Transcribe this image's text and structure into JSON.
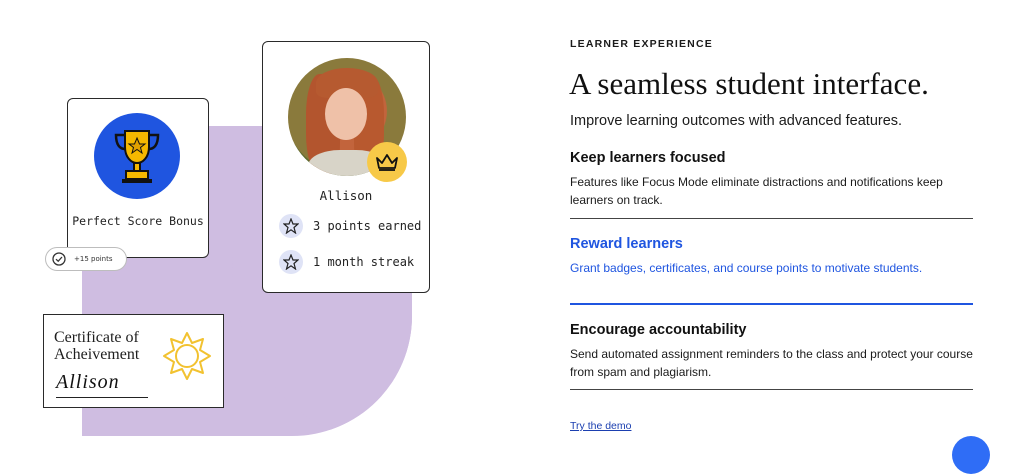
{
  "illustration": {
    "trophy_card": {
      "title": "Perfect Score Bonus",
      "icon": "trophy-icon",
      "circle_color": "#1f55e0"
    },
    "points_pill": {
      "label": "+15 points",
      "icon": "check-circle-icon"
    },
    "profile_card": {
      "name": "Allison",
      "avatar": "avatar-photo",
      "badge_icon": "crown-icon",
      "stats": [
        {
          "icon": "star-icon",
          "label": "3 points earned"
        },
        {
          "icon": "star-icon",
          "label": "1 month streak"
        }
      ]
    },
    "certificate": {
      "title": "Certificate of Acheivement",
      "signature": "Allison",
      "seal_icon": "sun-seal-icon"
    },
    "blob_color": "#cfbde1"
  },
  "content": {
    "eyebrow": "LEARNER EXPERIENCE",
    "headline": "A seamless student interface.",
    "subhead": "Improve learning outcomes with advanced features.",
    "features": [
      {
        "title": "Keep learners focused",
        "desc": "Features like Focus Mode eliminate distractions and notifications keep learners on track.",
        "active": false
      },
      {
        "title": "Reward learners",
        "desc": "Grant badges, certificates, and course points to motivate students.",
        "active": true
      },
      {
        "title": "Encourage accountability",
        "desc": "Send automated assignment reminders to the class and protect your course from spam and plagiarism.",
        "active": false
      }
    ],
    "demo_link": "Try the demo",
    "accent_color": "#1f55e0"
  }
}
